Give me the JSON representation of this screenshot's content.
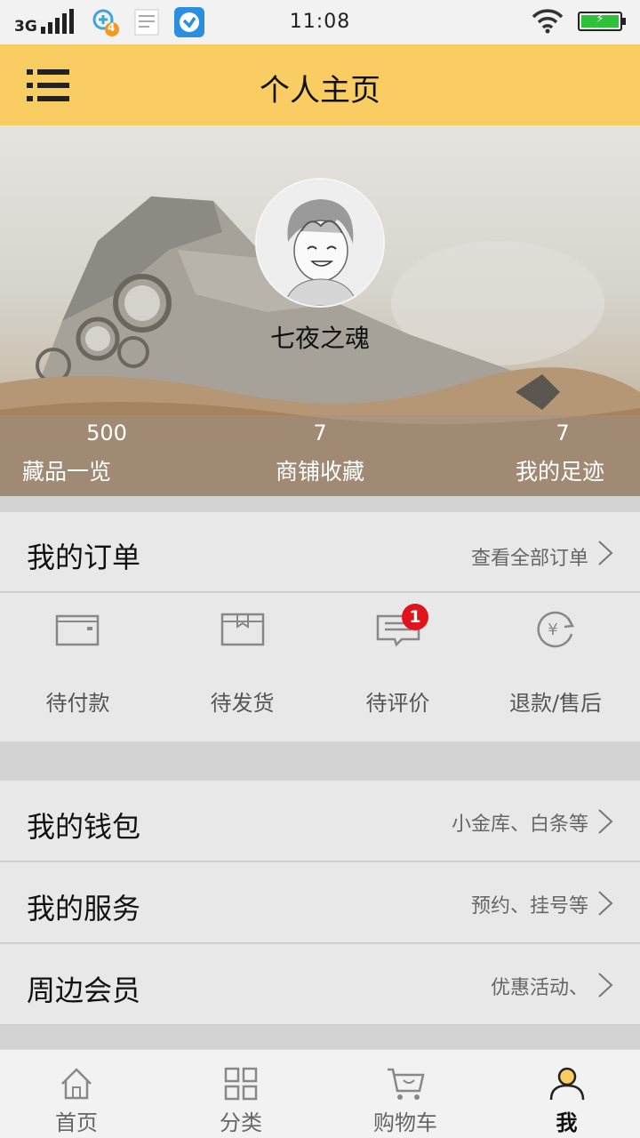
{
  "status_bar": {
    "network": "3G",
    "notification_count": "4",
    "time": "11:08",
    "battery_color": "#2fc13a",
    "icons": [
      "signal-icon",
      "add-app-icon",
      "notes-icon",
      "app-checkmark-icon",
      "wifi-icon",
      "battery-icon"
    ]
  },
  "header": {
    "title": "个人主页",
    "menu_icon": "hamburger-icon",
    "background_color": "#f9cd62"
  },
  "profile": {
    "username": "七夜之魂",
    "avatar": "anime-avatar",
    "stats": [
      {
        "value": "500",
        "label": "藏品一览"
      },
      {
        "value": "7",
        "label": "商铺收藏"
      },
      {
        "value": "7",
        "label": "我的足迹"
      }
    ]
  },
  "orders": {
    "title": "我的订单",
    "view_all": "查看全部订单",
    "items": [
      {
        "label": "待付款",
        "icon": "wallet-icon"
      },
      {
        "label": "待发货",
        "icon": "package-icon"
      },
      {
        "label": "待评价",
        "icon": "comment-icon",
        "badge": "1"
      },
      {
        "label": "退款/售后",
        "icon": "refund-icon"
      }
    ],
    "badge_color": "#e0151c"
  },
  "menu": [
    {
      "title": "我的钱包",
      "hint": "小金库、白条等"
    },
    {
      "title": "我的服务",
      "hint": "预约、挂号等"
    },
    {
      "title": "周边会员",
      "hint": "优惠活动、"
    }
  ],
  "tabbar": {
    "tabs": [
      {
        "label": "首页",
        "icon": "home-icon"
      },
      {
        "label": "分类",
        "icon": "grid-icon"
      },
      {
        "label": "购物车",
        "icon": "cart-icon"
      },
      {
        "label": "我",
        "icon": "user-icon",
        "active": true
      }
    ],
    "active_color": "#f9cd62"
  }
}
